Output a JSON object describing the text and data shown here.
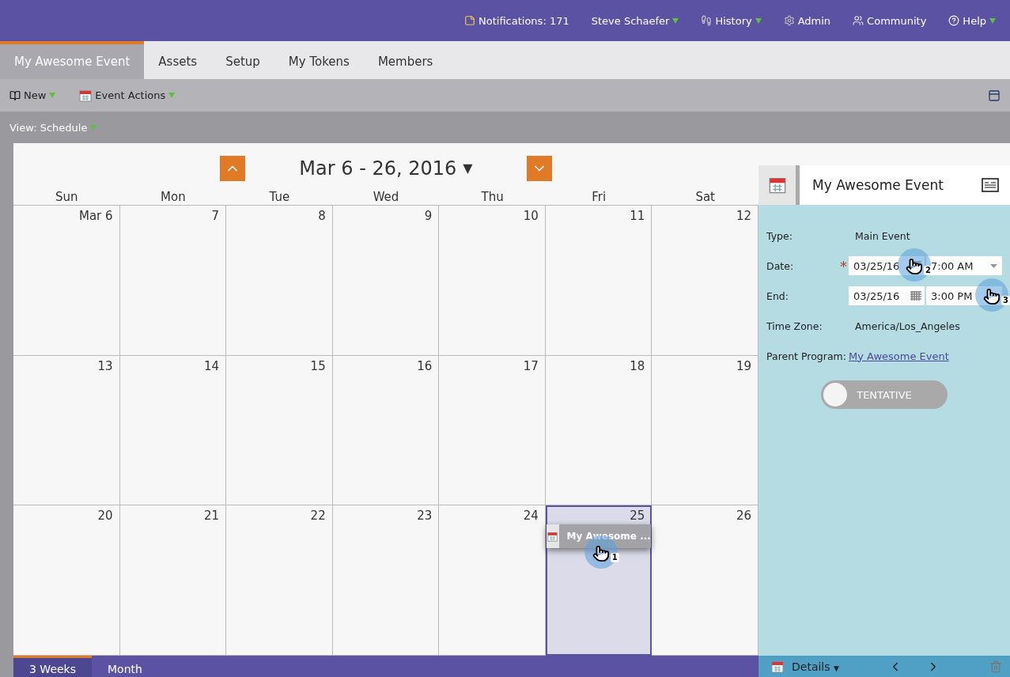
{
  "top_bar": {
    "items": [
      {
        "kind": "notifications",
        "label": "Notifications: 171",
        "dropdown": false
      },
      {
        "kind": "user",
        "label": "Steve Schaefer",
        "dropdown": true
      },
      {
        "kind": "history",
        "label": "History",
        "dropdown": true
      },
      {
        "kind": "admin",
        "label": "Admin",
        "dropdown": false
      },
      {
        "kind": "community",
        "label": "Community",
        "dropdown": false
      },
      {
        "kind": "help",
        "label": "Help",
        "dropdown": true
      }
    ]
  },
  "tabs": [
    {
      "label": "My Awesome Event",
      "selected": true
    },
    {
      "label": "Assets",
      "selected": false
    },
    {
      "label": "Setup",
      "selected": false
    },
    {
      "label": "My Tokens",
      "selected": false
    },
    {
      "label": "Members",
      "selected": false
    }
  ],
  "toolbar": {
    "items": [
      {
        "kind": "new",
        "label": "New"
      },
      {
        "kind": "actions",
        "label": "Event Actions"
      }
    ]
  },
  "view": {
    "label": "View: Schedule"
  },
  "calendar": {
    "title": "Mar 6 - 26, 2016",
    "caret": "▼",
    "weekdays": [
      "Sun",
      "Mon",
      "Tue",
      "Wed",
      "Thu",
      "Fri",
      "Sat"
    ],
    "weeks": [
      [
        {
          "day": "Mar 6",
          "selected": false
        },
        {
          "day": "7",
          "selected": false
        },
        {
          "day": "8",
          "selected": false
        },
        {
          "day": "9",
          "selected": false
        },
        {
          "day": "10",
          "selected": false
        },
        {
          "day": "11",
          "selected": false
        },
        {
          "day": "12",
          "selected": false
        }
      ],
      [
        {
          "day": "13",
          "selected": false
        },
        {
          "day": "14",
          "selected": false
        },
        {
          "day": "15",
          "selected": false
        },
        {
          "day": "16",
          "selected": false
        },
        {
          "day": "17",
          "selected": false
        },
        {
          "day": "18",
          "selected": false
        },
        {
          "day": "19",
          "selected": false
        }
      ],
      [
        {
          "day": "20",
          "selected": false
        },
        {
          "day": "21",
          "selected": false
        },
        {
          "day": "22",
          "selected": false
        },
        {
          "day": "23",
          "selected": false
        },
        {
          "day": "24",
          "selected": false
        },
        {
          "day": "25",
          "selected": true,
          "event": {
            "label": "My Awesome ...",
            "callout": "1"
          }
        },
        {
          "day": "26",
          "selected": false
        }
      ]
    ],
    "view_tabs": [
      {
        "label": "3 Weeks",
        "selected": true
      },
      {
        "label": "Month",
        "selected": false
      }
    ]
  },
  "details": {
    "title": "My Awesome Event",
    "type": {
      "label": "Type:",
      "value": "Main Event"
    },
    "date": {
      "label": "Date:",
      "required": "*",
      "date": "03/25/16",
      "time": "7:00 AM",
      "callout": "2"
    },
    "end": {
      "label": "End:",
      "date": "03/25/16",
      "time": "3:00 PM",
      "callout": "3"
    },
    "time_zone": {
      "label": "Time Zone:",
      "value": "America/Los_Angeles"
    },
    "parent_program": {
      "label": "Parent Program:",
      "value": "My Awesome Event"
    },
    "toggle": {
      "label": "TENTATIVE",
      "on": false
    },
    "footer": {
      "label": "Details"
    }
  }
}
